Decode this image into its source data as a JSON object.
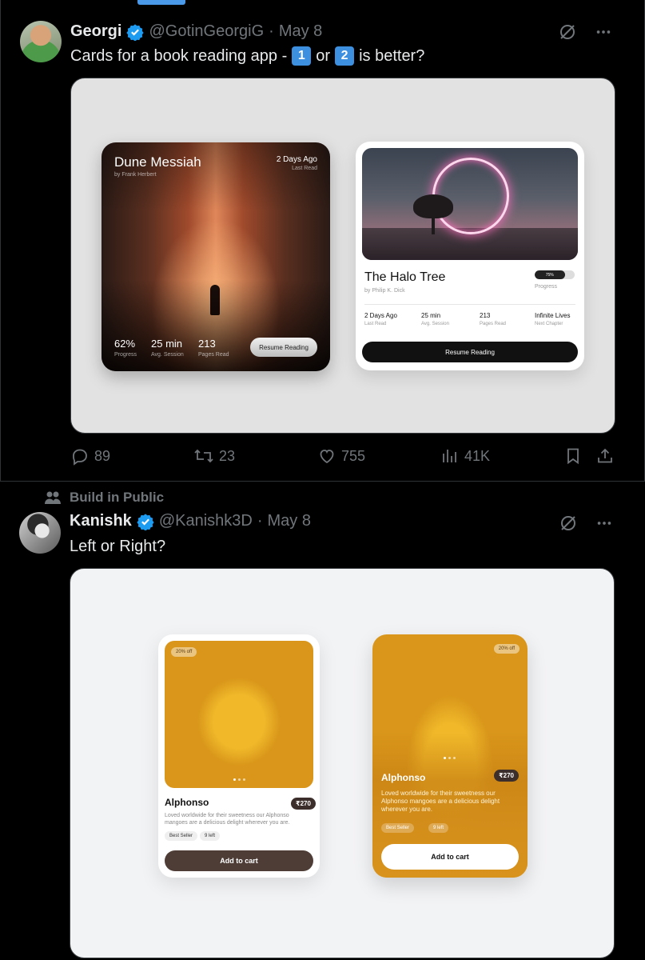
{
  "tweet1": {
    "author_name": "Georgi",
    "handle": "@GotinGeorgiG",
    "separator": "·",
    "date": "May 8",
    "text_before": "Cards for a book reading app -",
    "key1": "1",
    "text_or": "or",
    "key2": "2",
    "text_after": "is better?",
    "replies": "89",
    "reposts": "23",
    "likes": "755",
    "views": "41K",
    "card1": {
      "title": "Dune Messiah",
      "author": "by Frank Herbert",
      "last_read_value": "2 Days Ago",
      "last_read_label": "Last Read",
      "progress_value": "62%",
      "progress_label": "Progress",
      "session_value": "25 min",
      "session_label": "Avg. Session",
      "pages_value": "213",
      "pages_label": "Pages Read",
      "button": "Resume Reading"
    },
    "card2": {
      "title": "The Halo Tree",
      "author": "by Philip K. Dick",
      "progress_pct": "75%",
      "progress_fraction": 0.75,
      "progress_label": "Progress",
      "stats": [
        {
          "value": "2 Days Ago",
          "label": "Last Read"
        },
        {
          "value": "25 min",
          "label": "Avg. Session"
        },
        {
          "value": "213",
          "label": "Pages Read"
        },
        {
          "value": "Infinite Lives",
          "label": "Next Chapter"
        }
      ],
      "button": "Resume Reading"
    }
  },
  "tweet2": {
    "context": "Build in Public",
    "author_name": "Kanishk",
    "handle": "@Kanishk3D",
    "separator": "·",
    "date": "May 8",
    "text": "Left or Right?",
    "card1": {
      "badge": "20% off",
      "name": "Alphonso",
      "price": "₹270",
      "desc": "Loved worldwide for their sweetness our Alphonso mangoes are a delicious delight wherever you are.",
      "chip1": "Best Seller",
      "chip2": "9 left",
      "button": "Add to cart"
    },
    "card2": {
      "badge": "20% off",
      "name": "Alphonso",
      "price": "₹270",
      "desc": "Loved worldwide for their sweetness our Alphonso mangoes are a delicious delight wherever you are.",
      "chip1": "Best Seller",
      "chip2": "9 left",
      "button": "Add to cart"
    }
  },
  "colors": {
    "background": "#000000",
    "text": "#e7e9ea",
    "muted": "#71767b",
    "verified": "#1d9bf0",
    "accent": "#4a99e9"
  },
  "icons": [
    "verified-badge-icon",
    "grok-icon",
    "more-icon",
    "reply-icon",
    "repost-icon",
    "like-icon",
    "views-icon",
    "bookmark-icon",
    "share-icon",
    "community-icon"
  ]
}
